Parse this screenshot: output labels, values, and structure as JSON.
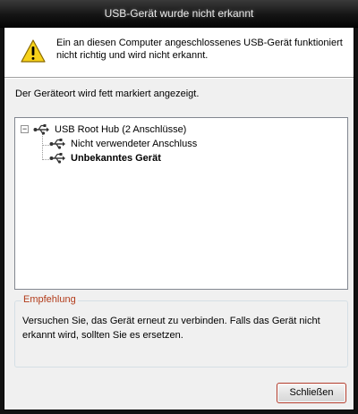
{
  "window": {
    "title": "USB-Gerät wurde nicht erkannt"
  },
  "header": {
    "icon": "warning-icon",
    "message": "Ein an diesen Computer angeschlossenes USB-Gerät  funktioniert nicht richtig und wird nicht erkannt."
  },
  "instruction": "Der Geräteort wird fett markiert angezeigt.",
  "tree": {
    "root": {
      "label": "USB Root Hub (2 Anschlüsse)",
      "expander": "−",
      "icon": "usb-icon",
      "expanded": true
    },
    "children": [
      {
        "label": "Nicht verwendeter Anschluss",
        "icon": "usb-icon",
        "bold": false
      },
      {
        "label": "Unbekanntes Gerät",
        "icon": "usb-icon",
        "bold": true
      }
    ]
  },
  "recommendation": {
    "caption": "Empfehlung",
    "text": "Versuchen Sie, das Gerät erneut zu verbinden. Falls das Gerät nicht erkannt wird, sollten Sie es ersetzen."
  },
  "buttons": {
    "close_label": "Schließen"
  },
  "colors": {
    "caption": "#b23b1a",
    "titlebar": "#151515",
    "button_border": "#b03a2a"
  }
}
